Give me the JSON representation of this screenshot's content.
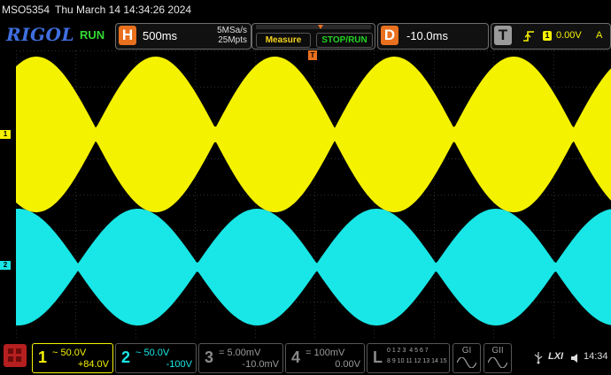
{
  "status": {
    "model": "MSO5354",
    "datetime": "Thu March 14 14:34:26 2024"
  },
  "topbar": {
    "brand": "RIGOL",
    "run_state": "RUN",
    "horizontal": {
      "letter": "H",
      "timebase": "500ms",
      "sample_rate": "5MSa/s",
      "memory_depth": "25Mpts"
    },
    "measure_label": "Measure",
    "stop_run_label": "STOP/RUN",
    "delay": {
      "letter": "D",
      "value": "-10.0ms"
    },
    "trigger": {
      "letter": "T",
      "source": "1",
      "level": "0.00V",
      "mode": "A"
    }
  },
  "channels": [
    {
      "num": "1",
      "coupling": "~",
      "scale": "50.0V",
      "offset": "+84.0V",
      "color": "#f5f200"
    },
    {
      "num": "2",
      "coupling": "~",
      "scale": "50.0V",
      "offset": "-100V",
      "color": "#19e6e6"
    },
    {
      "num": "3",
      "coupling": "=",
      "scale": "5.00mV",
      "offset": "-10.0mV",
      "color": "#808080"
    },
    {
      "num": "4",
      "coupling": "=",
      "scale": "100mV",
      "offset": "0.00V",
      "color": "#808080"
    }
  ],
  "logic": {
    "letter": "L",
    "row1": "0 1 2 3  4 5 6 7",
    "row2": "8 9 10 11 12 13 14 15"
  },
  "generators": [
    {
      "label": "GI"
    },
    {
      "label": "GII"
    }
  ],
  "system": {
    "lxi": "LXI",
    "time": "14:34"
  },
  "chart_data": {
    "type": "line",
    "series": [
      {
        "name": "1",
        "color": "#f5f200",
        "envelope": "amplitude-modulated carrier, 5 modulation cycles visible"
      },
      {
        "name": "2",
        "color": "#19e6e6",
        "envelope": "amplitude-modulated carrier, 5 modulation cycles visible"
      }
    ],
    "modulation_cycles_on_screen": 5,
    "grid": true
  }
}
